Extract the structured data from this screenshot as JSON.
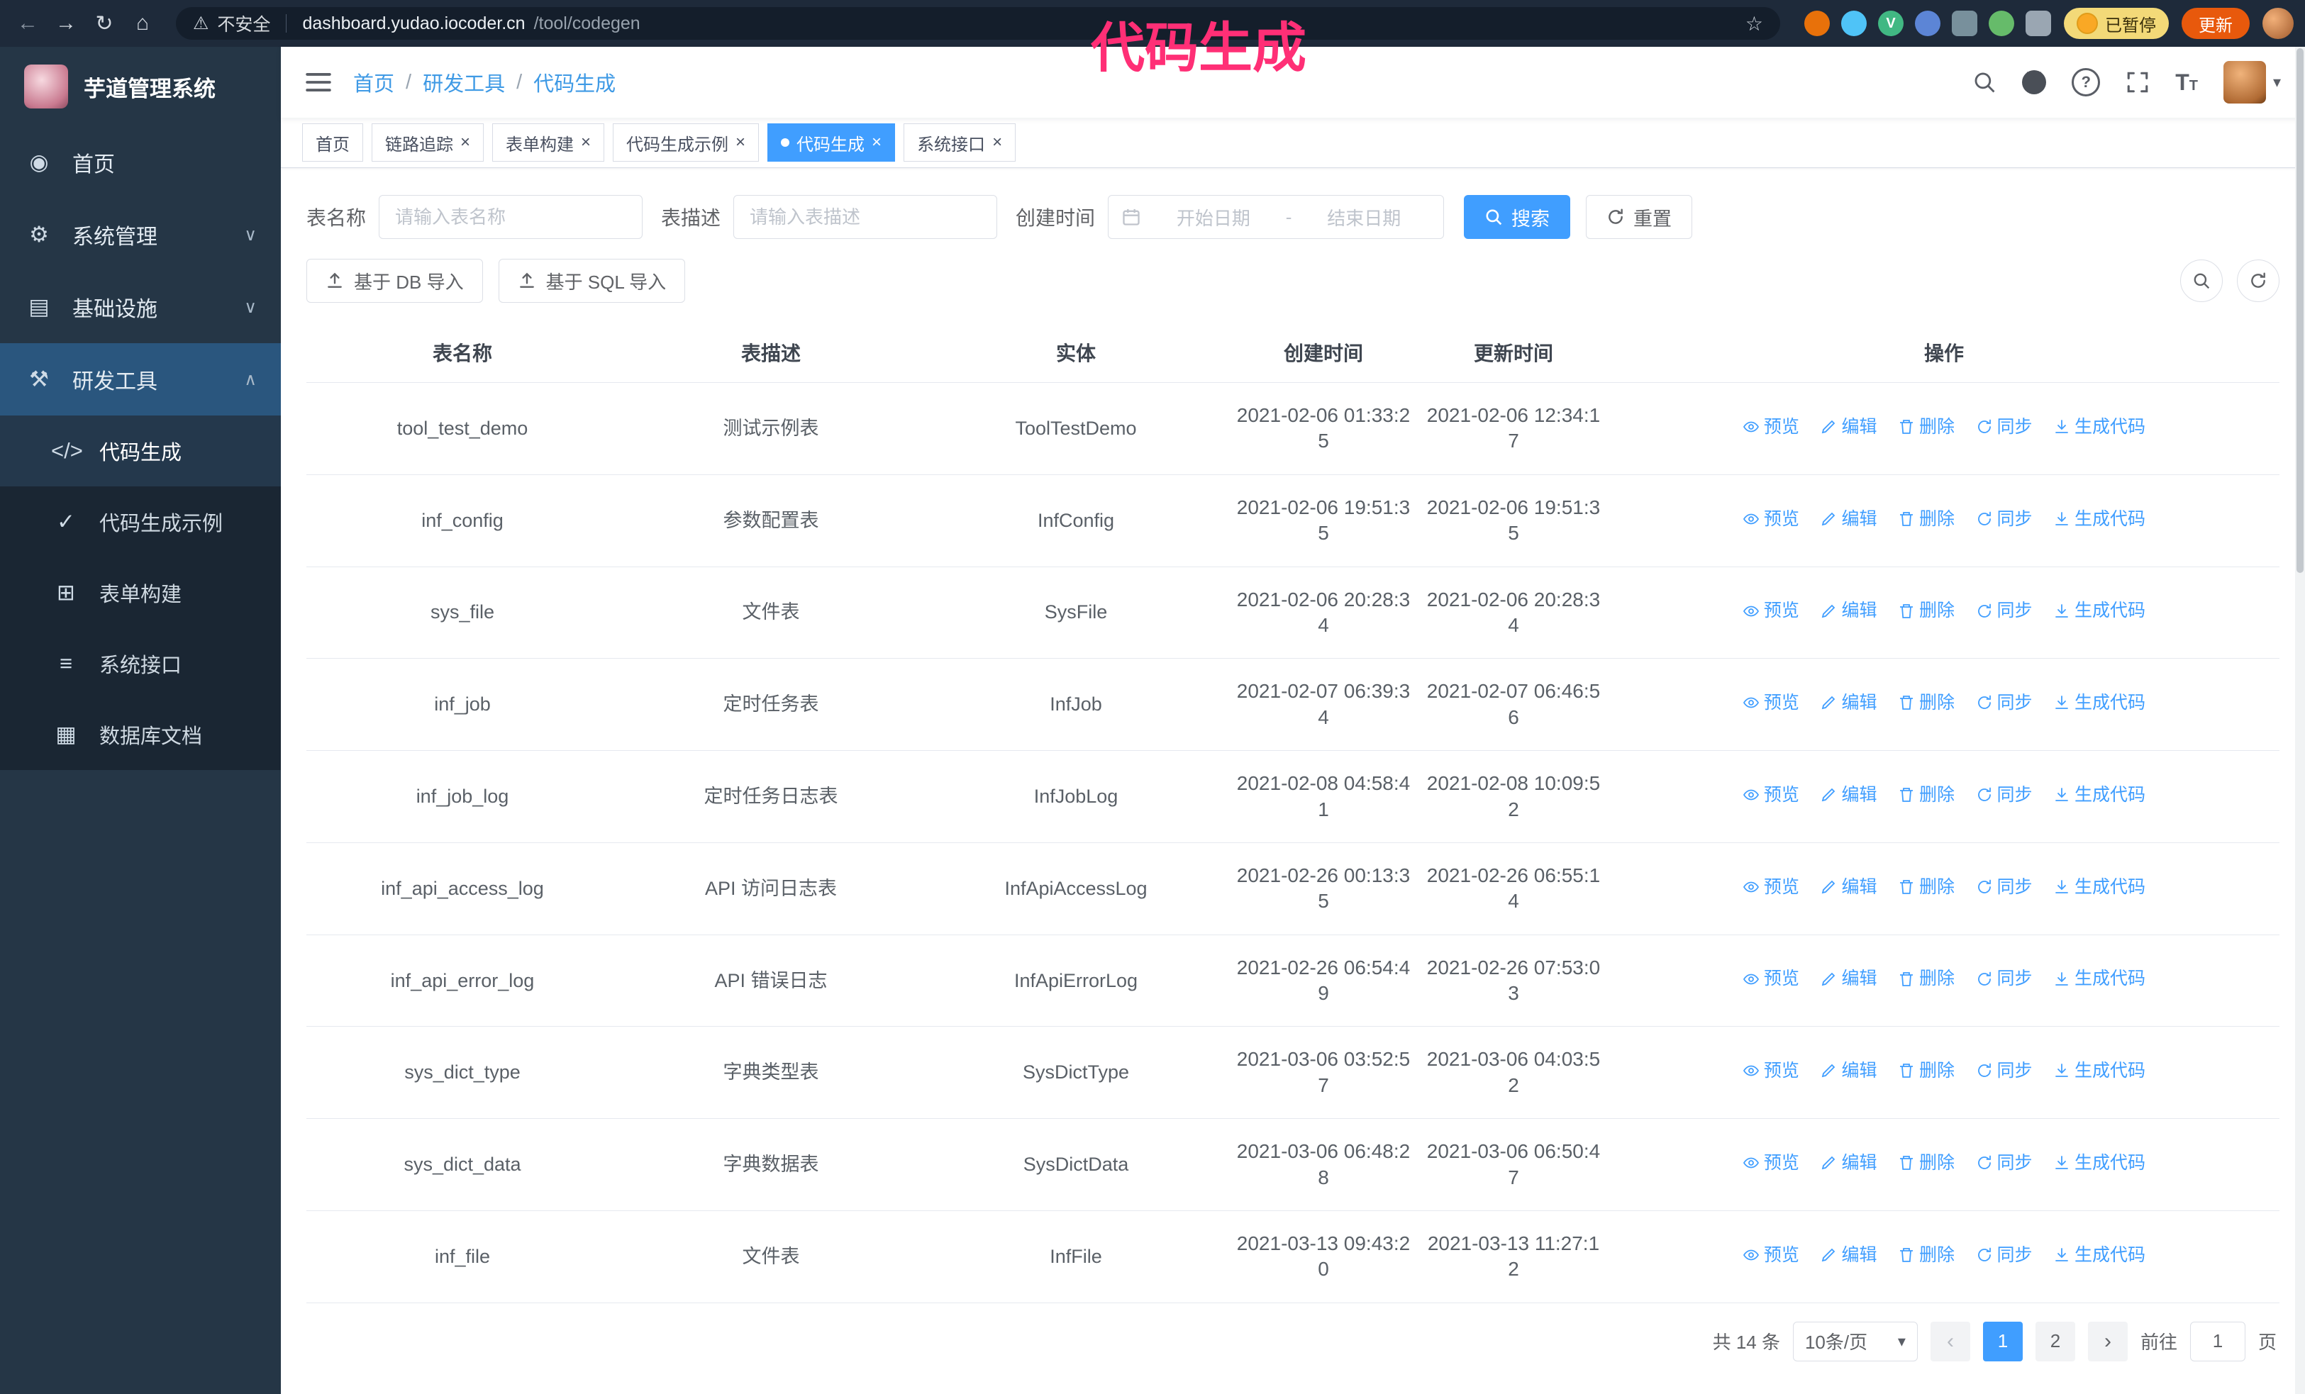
{
  "colors": {
    "accent": "#409eff",
    "annotation": "#ff2f76",
    "sidebar_bg": "#253646",
    "browser_bar": "#1e2a3a",
    "update_button": "#e8590c"
  },
  "browser": {
    "security_chip": "不安全",
    "url_host": "dashboard.yudao.iocoder.cn",
    "url_path": "/tool/codegen",
    "paused_chip": "已暂停",
    "update_button": "更新"
  },
  "annotation": {
    "text": "代码生成"
  },
  "sidebar": {
    "title": "芋道管理系统",
    "items": [
      {
        "label": "首页",
        "icon": "home-icon",
        "glyph": "◉",
        "chevron": ""
      },
      {
        "label": "系统管理",
        "icon": "gear-icon",
        "glyph": "⚙",
        "chevron": "∨"
      },
      {
        "label": "基础设施",
        "icon": "infrastructure-icon",
        "glyph": "▤",
        "chevron": "∨"
      },
      {
        "label": "研发工具",
        "icon": "dev-tools-icon",
        "glyph": "⚒",
        "chevron": "∧"
      }
    ],
    "children": [
      {
        "label": "代码生成",
        "icon": "code-icon",
        "glyph": "</>"
      },
      {
        "label": "代码生成示例",
        "icon": "code-example-icon",
        "glyph": "✓"
      },
      {
        "label": "表单构建",
        "icon": "form-builder-icon",
        "glyph": "⊞"
      },
      {
        "label": "系统接口",
        "icon": "api-icon",
        "glyph": "≡"
      },
      {
        "label": "数据库文档",
        "icon": "db-doc-icon",
        "glyph": "▦"
      }
    ]
  },
  "header": {
    "breadcrumb": {
      "items": [
        "首页",
        "研发工具",
        "代码生成"
      ],
      "separator": "/"
    }
  },
  "tabs": [
    {
      "label": "首页"
    },
    {
      "label": "链路追踪"
    },
    {
      "label": "表单构建"
    },
    {
      "label": "代码生成示例"
    },
    {
      "label": "代码生成"
    },
    {
      "label": "系统接口"
    }
  ],
  "filters": {
    "table_name_label": "表名称",
    "table_name_placeholder": "请输入表名称",
    "table_desc_label": "表描述",
    "table_desc_placeholder": "请输入表描述",
    "create_time_label": "创建时间",
    "start_placeholder": "开始日期",
    "end_placeholder": "结束日期",
    "range_separator": "-",
    "search_button": "搜索",
    "reset_button": "重置"
  },
  "toolbar": {
    "import_db": "基于 DB 导入",
    "import_sql": "基于 SQL 导入"
  },
  "table": {
    "columns": [
      "表名称",
      "表描述",
      "实体",
      "创建时间",
      "更新时间",
      "操作"
    ],
    "action_labels": [
      "预览",
      "编辑",
      "删除",
      "同步",
      "生成代码"
    ],
    "rows": [
      {
        "name": "tool_test_demo",
        "desc": "测试示例表",
        "entity": "ToolTestDemo",
        "created": "2021-02-06 01:33:25",
        "updated": "2021-02-06 12:34:17"
      },
      {
        "name": "inf_config",
        "desc": "参数配置表",
        "entity": "InfConfig",
        "created": "2021-02-06 19:51:35",
        "updated": "2021-02-06 19:51:35"
      },
      {
        "name": "sys_file",
        "desc": "文件表",
        "entity": "SysFile",
        "created": "2021-02-06 20:28:34",
        "updated": "2021-02-06 20:28:34"
      },
      {
        "name": "inf_job",
        "desc": "定时任务表",
        "entity": "InfJob",
        "created": "2021-02-07 06:39:34",
        "updated": "2021-02-07 06:46:56"
      },
      {
        "name": "inf_job_log",
        "desc": "定时任务日志表",
        "entity": "InfJobLog",
        "created": "2021-02-08 04:58:41",
        "updated": "2021-02-08 10:09:52"
      },
      {
        "name": "inf_api_access_log",
        "desc": "API 访问日志表",
        "entity": "InfApiAccessLog",
        "created": "2021-02-26 00:13:35",
        "updated": "2021-02-26 06:55:14"
      },
      {
        "name": "inf_api_error_log",
        "desc": "API 错误日志",
        "entity": "InfApiErrorLog",
        "created": "2021-02-26 06:54:49",
        "updated": "2021-02-26 07:53:03"
      },
      {
        "name": "sys_dict_type",
        "desc": "字典类型表",
        "entity": "SysDictType",
        "created": "2021-03-06 03:52:57",
        "updated": "2021-03-06 04:03:52"
      },
      {
        "name": "sys_dict_data",
        "desc": "字典数据表",
        "entity": "SysDictData",
        "created": "2021-03-06 06:48:28",
        "updated": "2021-03-06 06:50:47"
      },
      {
        "name": "inf_file",
        "desc": "文件表",
        "entity": "InfFile",
        "created": "2021-03-13 09:43:20",
        "updated": "2021-03-13 11:27:12"
      }
    ]
  },
  "pagination": {
    "total": "共 14 条",
    "page_size": "10条/页",
    "pages": [
      "1",
      "2"
    ],
    "active_page": "1",
    "goto_label": "前往",
    "goto_value": "1",
    "goto_suffix": "页"
  },
  "icons": {
    "close": "×",
    "caret": "▾",
    "back": "←",
    "forward": "→",
    "reload": "↻",
    "home": "⌂",
    "warning": "⚠",
    "star": "☆",
    "pipe": "|",
    "question": "?",
    "prev": "‹",
    "next": "›",
    "font_large": "T",
    "font_small": "T"
  }
}
